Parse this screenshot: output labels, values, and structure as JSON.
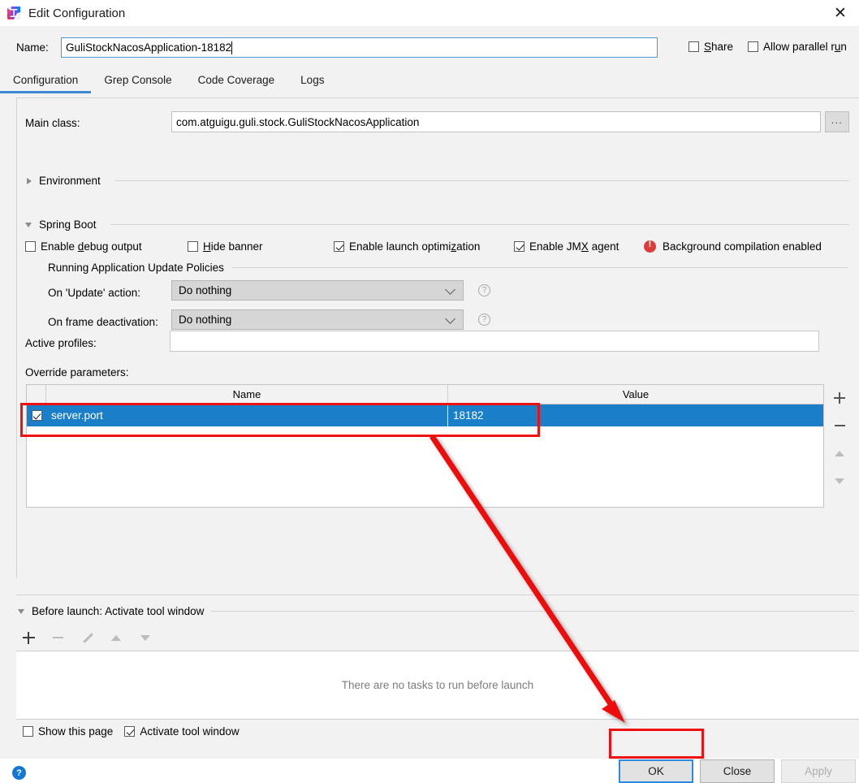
{
  "window": {
    "title": "Edit Configuration",
    "app_icon": "intellij-idea-icon",
    "close_label": "✕"
  },
  "name_row": {
    "label": "Name:",
    "value": "GuliStockNacosApplication-18182",
    "share": {
      "label": "Share",
      "mnemonic": "S",
      "checked": false
    },
    "allow_parallel": {
      "label": "Allow parallel run",
      "mnemonic": "u",
      "checked": false
    }
  },
  "tabs": [
    {
      "label": "Configuration",
      "active": true
    },
    {
      "label": "Grep Console",
      "active": false
    },
    {
      "label": "Code Coverage",
      "active": false
    },
    {
      "label": "Logs",
      "active": false
    }
  ],
  "main_class": {
    "label": "Main class:",
    "value": "com.atguigu.guli.stock.GuliStockNacosApplication",
    "browse_label": "..."
  },
  "environment": {
    "label": "Environment",
    "expanded": false
  },
  "spring_boot": {
    "label": "Spring Boot",
    "expanded": true,
    "checkboxes": [
      {
        "label": "Enable debug output",
        "checked": false
      },
      {
        "label": "Hide banner",
        "checked": false
      },
      {
        "label": "Enable launch optimization",
        "checked": true
      },
      {
        "label": "Enable JMX agent",
        "checked": true
      }
    ],
    "warning": {
      "icon": "error-icon",
      "text": "Background compilation enabled"
    }
  },
  "update_policies": {
    "title": "Running Application Update Policies",
    "rows": [
      {
        "label": "On 'Update' action:",
        "value": "Do nothing",
        "help": "?"
      },
      {
        "label": "On frame deactivation:",
        "value": "Do nothing",
        "help": "?"
      }
    ]
  },
  "active_profiles": {
    "label": "Active profiles:",
    "value": "",
    "placeholder": ""
  },
  "override_parameters": {
    "label": "Override parameters:",
    "columns": [
      "Name",
      "Value"
    ],
    "rows": [
      {
        "checked": true,
        "name": "server.port",
        "value": "18182",
        "selected": true
      }
    ],
    "toolbar": [
      {
        "name": "add",
        "glyph": "+",
        "enabled": true
      },
      {
        "name": "remove",
        "glyph": "−",
        "enabled": true
      },
      {
        "name": "move-up",
        "glyph": "▲",
        "enabled": false
      },
      {
        "name": "move-down",
        "glyph": "▼",
        "enabled": false
      }
    ]
  },
  "before_launch": {
    "title": "Before launch: Activate tool window",
    "expanded": true,
    "toolbar": [
      {
        "name": "add",
        "glyph": "+",
        "enabled": true
      },
      {
        "name": "remove",
        "glyph": "−",
        "enabled": false
      },
      {
        "name": "edit",
        "glyph": "✎",
        "enabled": false
      },
      {
        "name": "move-up",
        "glyph": "▲",
        "enabled": false
      },
      {
        "name": "move-down",
        "glyph": "▼",
        "enabled": false
      }
    ],
    "empty_text": "There are no tasks to run before launch",
    "show_this_page": {
      "label": "Show this page",
      "checked": false
    },
    "activate_tool_window": {
      "label": "Activate tool window",
      "checked": true
    }
  },
  "footer": {
    "help_label": "?",
    "ok_label": "OK",
    "close_label": "Close",
    "apply_label": "Apply",
    "apply_enabled": false
  },
  "annotations": {
    "color": "#ee1111",
    "highlight_row": true,
    "highlight_ok": true,
    "arrow_from_row_to_ok": true
  }
}
